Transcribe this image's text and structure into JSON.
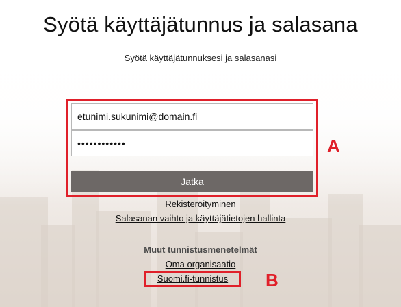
{
  "page": {
    "title": "Syötä käyttäjätunnus ja salasana",
    "subtitle": "Syötä käyttäjätunnuksesi ja salasanasi"
  },
  "login_form": {
    "email_value": "etunimi.sukunimi@domain.fi",
    "password_value": "••••••••••••",
    "submit_label": "Jatka"
  },
  "links": {
    "register": "Rekisteröityminen",
    "password_change": "Salasanan vaihto ja käyttäjätietojen hallinta"
  },
  "other_methods": {
    "heading": "Muut tunnistusmenetelmät",
    "organization": "Oma organisaatio",
    "suomi_fi": "Suomi.fi-tunnistus"
  },
  "annotations": {
    "a": "A",
    "b": "B"
  },
  "colors": {
    "highlight": "#e0202a",
    "button": "#6d6866"
  }
}
